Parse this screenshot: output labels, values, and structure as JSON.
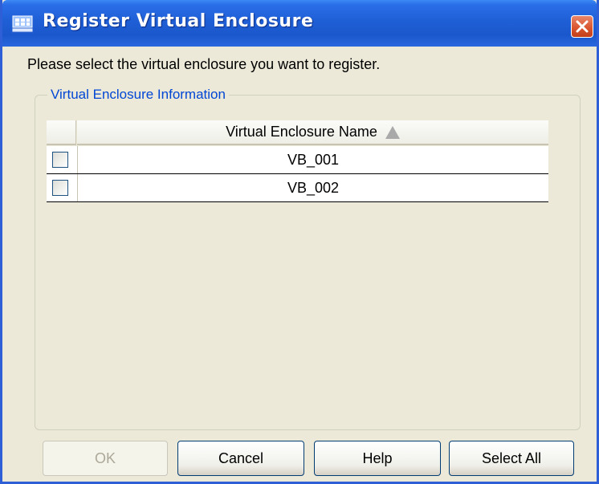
{
  "window": {
    "title": "Register Virtual Enclosure",
    "title_icon": "app-window-icon",
    "close_icon": "close-icon"
  },
  "instruction": "Please select the virtual enclosure you want to register.",
  "group": {
    "label": "Virtual Enclosure Information"
  },
  "table": {
    "columns": [
      "",
      "Virtual Enclosure Name"
    ],
    "sort": "ascending",
    "rows": [
      {
        "checked": false,
        "name": "VB_001"
      },
      {
        "checked": false,
        "name": "VB_002"
      }
    ]
  },
  "buttons": {
    "ok": {
      "label": "OK",
      "enabled": false
    },
    "cancel": {
      "label": "Cancel",
      "enabled": true
    },
    "help": {
      "label": "Help",
      "enabled": true
    },
    "select_all": {
      "label": "Select All",
      "enabled": true
    }
  },
  "colors": {
    "titlebar": "#1f5fd6",
    "window_bg": "#ece9d8",
    "group_label": "#0046d5",
    "close_button": "#d9532c"
  }
}
